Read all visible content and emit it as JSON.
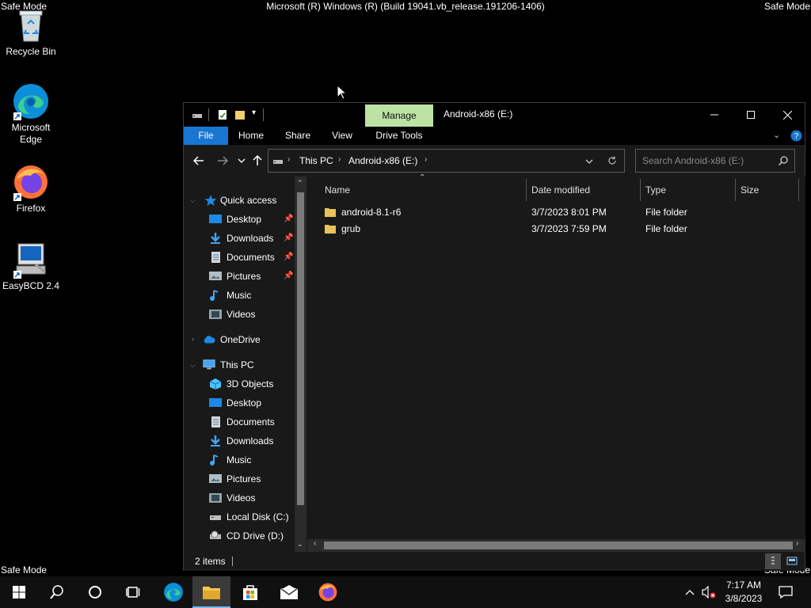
{
  "safe_mode": {
    "label": "Safe Mode",
    "build": "Microsoft (R) Windows (R) (Build 19041.vb_release.191206-1406)"
  },
  "desktop_icons": [
    {
      "label": "Recycle Bin"
    },
    {
      "label": "Microsoft Edge"
    },
    {
      "label": "Firefox"
    },
    {
      "label": "EasyBCD 2.4"
    }
  ],
  "window": {
    "title": "Android-x86 (E:)",
    "manage_tab": "Manage",
    "ribbon_tabs": [
      "File",
      "Home",
      "Share",
      "View",
      "Drive Tools"
    ],
    "breadcrumb": [
      "This PC",
      "Android-x86 (E:)"
    ],
    "search_placeholder": "Search Android-x86 (E:)",
    "nav": {
      "quick_access": "Quick access",
      "quick_items": [
        {
          "label": "Desktop",
          "pinned": true
        },
        {
          "label": "Downloads",
          "pinned": true
        },
        {
          "label": "Documents",
          "pinned": true
        },
        {
          "label": "Pictures",
          "pinned": true
        },
        {
          "label": "Music",
          "pinned": false
        },
        {
          "label": "Videos",
          "pinned": false
        }
      ],
      "onedrive": "OneDrive",
      "this_pc": "This PC",
      "pc_items": [
        "3D Objects",
        "Desktop",
        "Documents",
        "Downloads",
        "Music",
        "Pictures",
        "Videos",
        "Local Disk (C:)",
        "CD Drive (D:)"
      ]
    },
    "columns": [
      "Name",
      "Date modified",
      "Type",
      "Size"
    ],
    "files": [
      {
        "name": "android-8.1-r6",
        "date": "3/7/2023 8:01 PM",
        "type": "File folder"
      },
      {
        "name": "grub",
        "date": "3/7/2023 7:59 PM",
        "type": "File folder"
      }
    ],
    "status": "2 items"
  },
  "taskbar": {
    "time": "7:17 AM",
    "date": "3/8/2023"
  },
  "colors": {
    "accent": "#1976d2",
    "manage_tab": "#bde3a4",
    "window_bg": "#191919",
    "folder": "#e8c35a"
  }
}
